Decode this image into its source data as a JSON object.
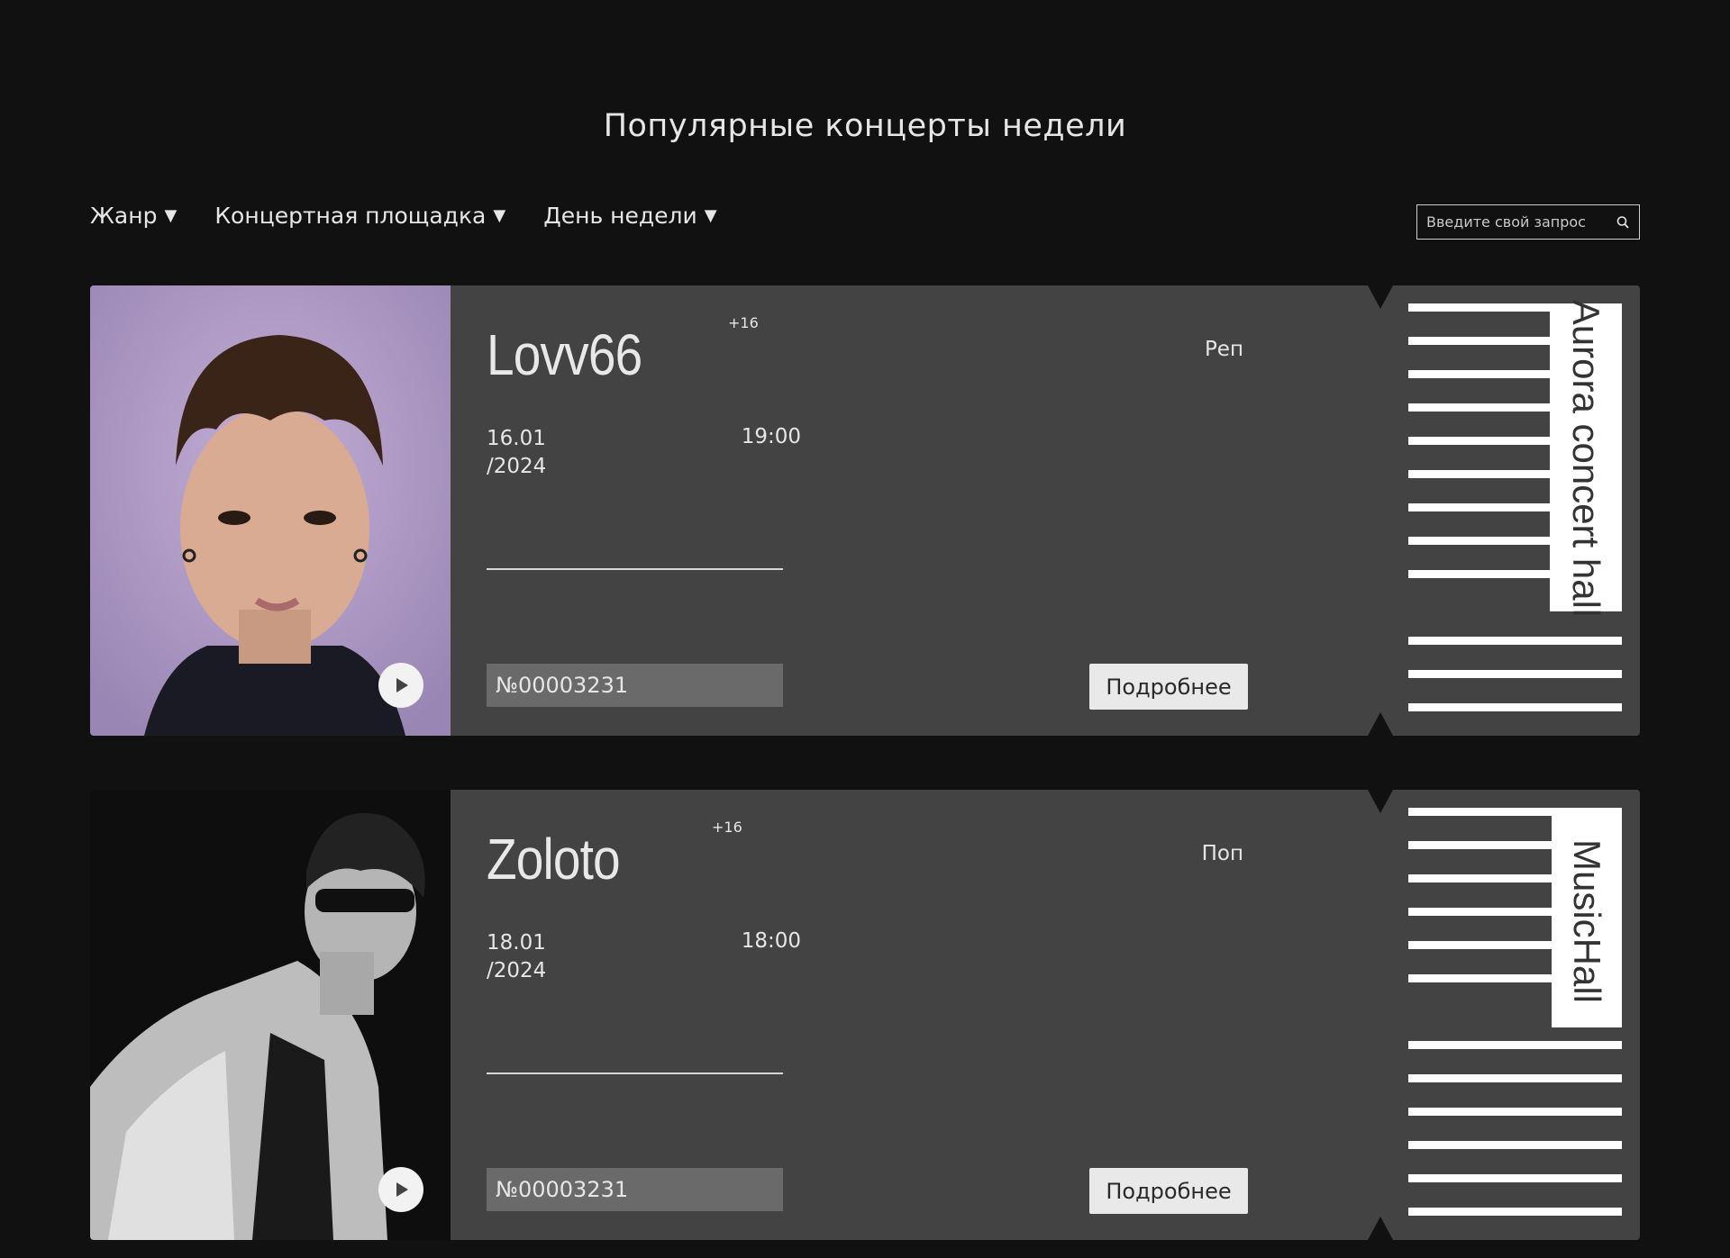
{
  "header": {
    "title": "Популярные концерты недели"
  },
  "filters": [
    {
      "label": "Жанр",
      "caret": "▼"
    },
    {
      "label": "Концертная площадка",
      "caret": "▼"
    },
    {
      "label": "День недели",
      "caret": "▼"
    }
  ],
  "search": {
    "placeholder": "Введите свой запрос"
  },
  "tickets": [
    {
      "artist": "Lovv66",
      "age": "+16",
      "genre": "Реп",
      "date_day": "16.01",
      "date_year": "/2024",
      "time": "19:00",
      "number": "№00003231",
      "more_label": "Подробнее",
      "venue": "Aurora concert hall"
    },
    {
      "artist": "Zoloto",
      "age": "+16",
      "genre": "Поп",
      "date_day": "18.01",
      "date_year": "/2024",
      "time": "18:00",
      "number": "№00003231",
      "more_label": "Подробнее",
      "venue": "MusicHall"
    }
  ],
  "colors": {
    "background": "#111112",
    "card": "#434343",
    "button": "#e9e9e9",
    "number_box": "#6a6a6a"
  }
}
